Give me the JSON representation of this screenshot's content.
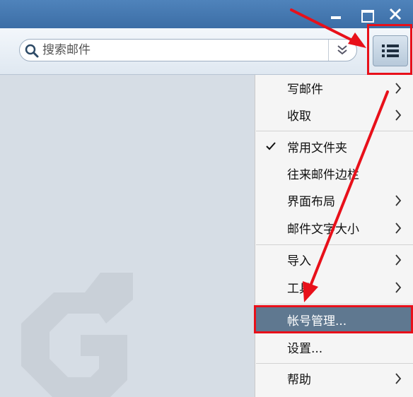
{
  "search": {
    "placeholder": "搜索邮件",
    "value": ""
  },
  "menu": {
    "items": [
      {
        "label": "写邮件",
        "has_submenu": true,
        "checked": false
      },
      {
        "label": "收取",
        "has_submenu": true,
        "checked": false
      },
      {
        "label": "常用文件夹",
        "has_submenu": false,
        "checked": true
      },
      {
        "label": "往来邮件边栏",
        "has_submenu": false,
        "checked": false
      },
      {
        "label": "界面布局",
        "has_submenu": true,
        "checked": false
      },
      {
        "label": "邮件文字大小",
        "has_submenu": true,
        "checked": false
      },
      {
        "label": "导入",
        "has_submenu": true,
        "checked": false
      },
      {
        "label": "工具",
        "has_submenu": true,
        "checked": false
      },
      {
        "label": "帐号管理...",
        "has_submenu": false,
        "checked": false,
        "highlighted": true
      },
      {
        "label": "设置...",
        "has_submenu": false,
        "checked": false
      },
      {
        "label": "帮助",
        "has_submenu": true,
        "checked": false
      }
    ]
  },
  "icons": {
    "minimize": "minimize-icon",
    "maximize": "maximize-icon",
    "close": "close-icon",
    "search": "search-icon",
    "dropdown": "double-chevron-down-icon",
    "menu": "menu-list-icon",
    "logo": "foxmail-logo-icon"
  },
  "colors": {
    "titlebar": "#4577ae",
    "menu_highlight": "#5f7890",
    "annotation": "#e8101a"
  }
}
